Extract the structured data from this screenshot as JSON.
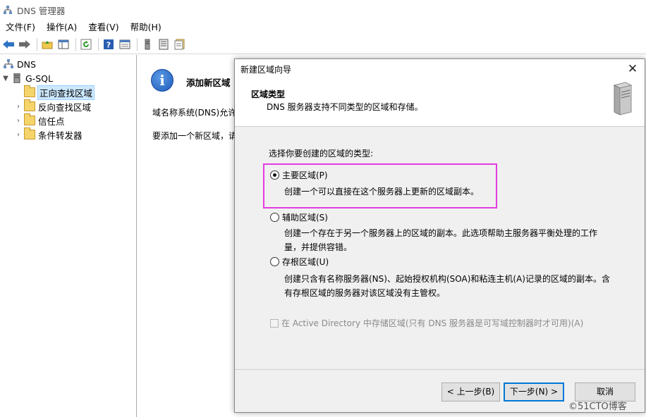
{
  "window": {
    "title": "DNS 管理器"
  },
  "menu": [
    "文件(F)",
    "操作(A)",
    "查看(V)",
    "帮助(H)"
  ],
  "toolbar": [
    "back-arrow-icon",
    "forward-arrow-icon",
    "up-folder-icon",
    "show-hide-tree-icon",
    "refresh-icon",
    "help-icon",
    "properties-icon",
    "server-list-icon",
    "record-list-icon",
    "export-list-icon"
  ],
  "tree": {
    "root": "DNS",
    "server": "G-SQL",
    "items": [
      "正向查找区域",
      "反向查找区域",
      "信任点",
      "条件转发器"
    ]
  },
  "right_pane": {
    "heading": "添加新区域",
    "text1": "域名称系统(DNS)允许",
    "text2": "要添加一个新区域，请"
  },
  "dialog": {
    "title": "新建区域向导",
    "close": "✕",
    "header_title": "区域类型",
    "header_subtitle": "DNS 服务器支持不同类型的区域和存储。",
    "prompt": "选择你要创建的区域的类型:",
    "options": [
      {
        "label": "主要区域(P)",
        "checked": true,
        "desc": [
          "创建一个可以直接在这个服务器上更新的区域副本。"
        ]
      },
      {
        "label": "辅助区域(S)",
        "checked": false,
        "desc": [
          "创建一个存在于另一个服务器上的区域的副本。此选项帮助主服务器平衡处理的工作",
          "量，并提供容错。"
        ]
      },
      {
        "label": "存根区域(U)",
        "checked": false,
        "desc": [
          "创建只含有名称服务器(NS)、起始授权机构(SOA)和粘连主机(A)记录的区域的副本。含",
          "有存根区域的服务器对该区域没有主管权。"
        ]
      }
    ],
    "ad_checkbox": "在 Active Directory 中存储区域(只有 DNS 服务器是可写域控制器时才可用)(A)",
    "buttons": {
      "back": "< 上一步(B)",
      "next": "下一步(N) >",
      "cancel": "取消"
    }
  },
  "watermark": "©51CTO博客",
  "colors": {
    "highlight": "#e43be0",
    "primary_button_border": "#0078d7",
    "selection": "#cce8ff"
  }
}
